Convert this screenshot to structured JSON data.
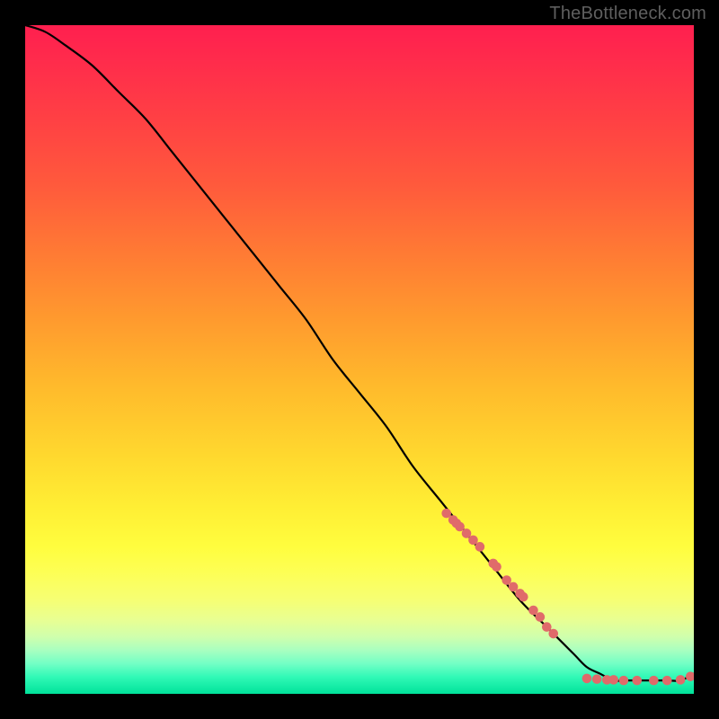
{
  "watermark": "TheBottleneck.com",
  "chart_data": {
    "type": "line",
    "title": "",
    "xlabel": "",
    "ylabel": "",
    "xlim": [
      0,
      100
    ],
    "ylim": [
      0,
      100
    ],
    "grid": false,
    "legend": false,
    "background_gradient": {
      "direction": "vertical",
      "stops": [
        {
          "pos": 0.0,
          "color": "#ff1f4f"
        },
        {
          "pos": 0.5,
          "color": "#ffba2c"
        },
        {
          "pos": 0.8,
          "color": "#fdff56"
        },
        {
          "pos": 0.95,
          "color": "#72ffc5"
        },
        {
          "pos": 1.0,
          "color": "#00e29a"
        }
      ]
    },
    "series": [
      {
        "name": "bottleneck-curve",
        "type": "line",
        "color": "#000000",
        "x": [
          0,
          3,
          6,
          10,
          14,
          18,
          22,
          26,
          30,
          34,
          38,
          42,
          46,
          50,
          54,
          58,
          62,
          66,
          70,
          74,
          78,
          82,
          84,
          86,
          88,
          90,
          92,
          94,
          96,
          98,
          100
        ],
        "y": [
          100,
          99,
          97,
          94,
          90,
          86,
          81,
          76,
          71,
          66,
          61,
          56,
          50,
          45,
          40,
          34,
          29,
          24,
          19,
          14,
          10,
          6,
          4,
          3,
          2,
          2,
          2,
          2,
          2,
          2,
          3
        ]
      },
      {
        "name": "points-on-curve",
        "type": "scatter",
        "color": "#e06a6a",
        "x": [
          63,
          64,
          64.5,
          65,
          66,
          67,
          68,
          70,
          70.5,
          72,
          73,
          74,
          74.5,
          76,
          77,
          78,
          79,
          84,
          85.5,
          87,
          88,
          89.5,
          91.5,
          94,
          96,
          98,
          99.5
        ],
        "y": [
          27,
          26,
          25.5,
          25,
          24,
          23,
          22,
          19.5,
          19,
          17,
          16,
          15,
          14.5,
          12.5,
          11.5,
          10,
          9,
          2.3,
          2.2,
          2.1,
          2.1,
          2.0,
          2.0,
          2.0,
          2.0,
          2.1,
          2.6
        ],
        "marker_radius": 5.3
      }
    ]
  }
}
